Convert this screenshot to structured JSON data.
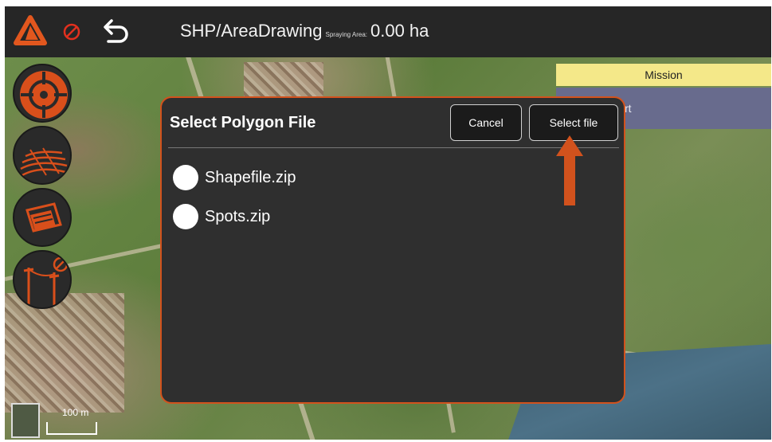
{
  "header": {
    "title": "SHP/AreaDrawing",
    "spraying_area_label": "Spraying Area:",
    "spraying_area_value": "0.00 ha",
    "icons": [
      "app-logo-icon",
      "no-fly-icon",
      "back-arrow-icon"
    ]
  },
  "left_toolbar": {
    "items": [
      "target-crosshair-icon",
      "field-rows-icon",
      "layers-icon",
      "power-line-icon"
    ]
  },
  "mission_panel": {
    "tab_label": "Mission",
    "start_label": "rt"
  },
  "map": {
    "scale_label": "100 m"
  },
  "dialog": {
    "title": "Select Polygon File",
    "cancel_label": "Cancel",
    "select_label": "Select file",
    "files": [
      "Shapefile.zip",
      "Spots.zip"
    ]
  },
  "colors": {
    "accent": "#d2521d",
    "topbar": "#262626",
    "dialog_bg": "#2f2f2f",
    "mission_tab": "#f4e889",
    "mission_start": "#686b8d"
  }
}
